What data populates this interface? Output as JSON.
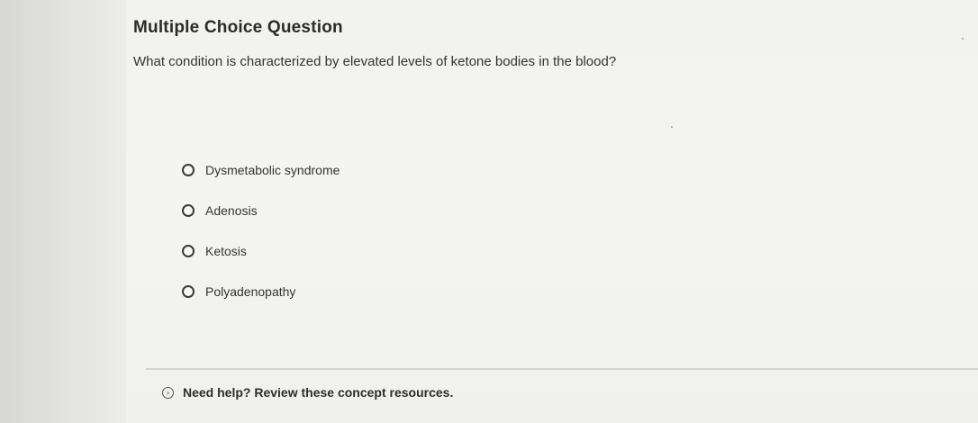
{
  "question_card": {
    "title": "Multiple Choice Question",
    "question": "What condition is characterized by elevated levels of ketone bodies in the blood?",
    "options": [
      {
        "label": "Dysmetabolic syndrome"
      },
      {
        "label": "Adenosis"
      },
      {
        "label": "Ketosis"
      },
      {
        "label": "Polyadenopathy"
      }
    ]
  },
  "help": {
    "icon": "chevron-circle-icon",
    "text": "Need help? Review these concept resources."
  }
}
